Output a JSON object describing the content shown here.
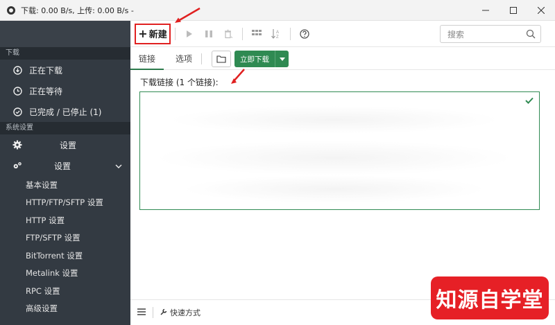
{
  "window": {
    "title": "下载: 0.00 B/s, 上传: 0.00 B/s -",
    "minimize_icon": "minimize-icon",
    "maximize_icon": "maximize-icon",
    "close_icon": "close-icon"
  },
  "sidebar": {
    "section_download": "下载",
    "items": [
      {
        "label": "正在下载",
        "icon": "download-arrow-icon"
      },
      {
        "label": "正在等待",
        "icon": "clock-icon"
      },
      {
        "label": "已完成 / 已停止 (1)",
        "icon": "check-circle-icon"
      }
    ],
    "section_settings": "系统设置",
    "settings_item": "设置",
    "settings_expand": "设置",
    "sub_items": [
      "基本设置",
      "HTTP/FTP/SFTP 设置",
      "HTTP 设置",
      "FTP/SFTP 设置",
      "BitTorrent 设置",
      "Metalink 设置",
      "RPC 设置",
      "高级设置"
    ]
  },
  "toolbar": {
    "new_label": "新建",
    "search_placeholder": "搜索"
  },
  "tabs": {
    "links": "链接",
    "options": "选项",
    "download_now": "立即下载"
  },
  "content": {
    "links_label": "下载链接 (1 个链接):"
  },
  "statusbar": {
    "shortcut": "快速方式"
  },
  "watermark": "知源自学堂",
  "colors": {
    "sidebar_bg": "#333a42",
    "accent_green": "#2f8a52",
    "highlight_red": "#e02020"
  }
}
